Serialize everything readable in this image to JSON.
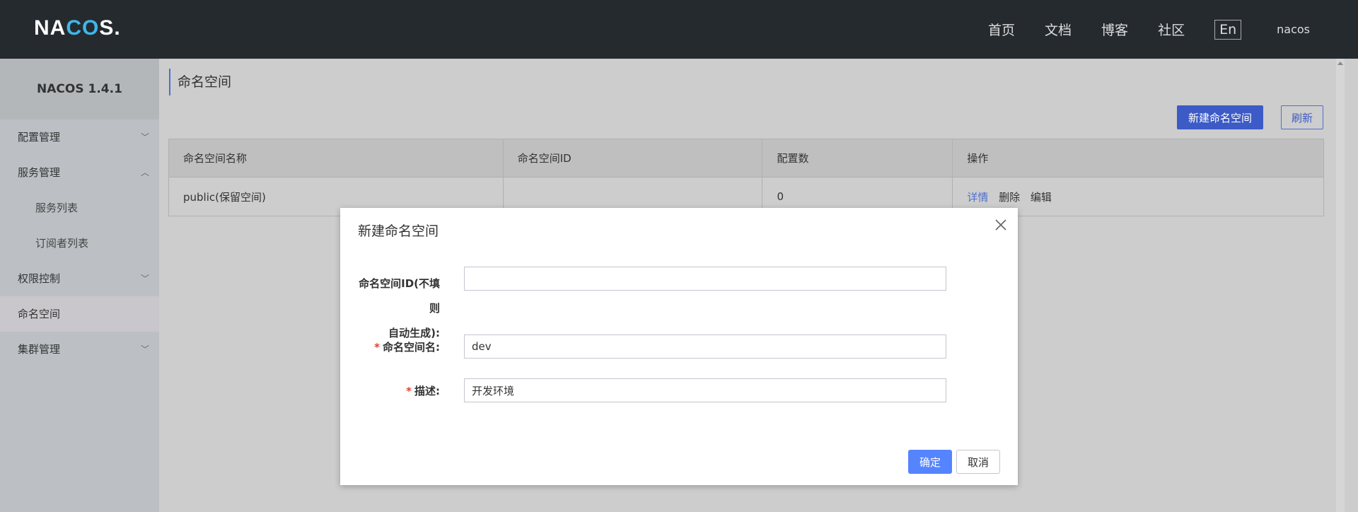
{
  "header": {
    "logo": "NACOS.",
    "nav": [
      "首页",
      "文档",
      "博客",
      "社区"
    ],
    "lang": "En",
    "user": "nacos"
  },
  "sidebar": {
    "title": "NACOS 1.4.1",
    "items": [
      {
        "label": "配置管理",
        "chevron": "down"
      },
      {
        "label": "服务管理",
        "chevron": "up"
      },
      {
        "label": "服务列表"
      },
      {
        "label": "订阅者列表"
      },
      {
        "label": "权限控制",
        "chevron": "down"
      },
      {
        "label": "命名空间",
        "active": true
      },
      {
        "label": "集群管理",
        "chevron": "down"
      }
    ]
  },
  "main": {
    "title": "命名空间",
    "new_button": "新建命名空间",
    "refresh_button": "刷新",
    "table": {
      "headers": [
        "命名空间名称",
        "命名空间ID",
        "配置数",
        "操作"
      ],
      "rows": [
        {
          "name": "public(保留空间)",
          "id": "",
          "count": "0",
          "actions": [
            "详情",
            "删除",
            "编辑"
          ]
        }
      ]
    }
  },
  "modal": {
    "title": "新建命名空间",
    "id_label_line1": "命名空间ID(不填则",
    "id_label_line2": "自动生成):",
    "id_value": "",
    "name_label": "命名空间名:",
    "name_value": "dev",
    "desc_label": "描述:",
    "desc_value": "开发环境",
    "ok": "确定",
    "cancel": "取消"
  },
  "colors": {
    "topbar": "#252a2f",
    "primary": "#3d5bc6",
    "ok_button": "#5584ff",
    "required_star": "#e53e2e"
  }
}
